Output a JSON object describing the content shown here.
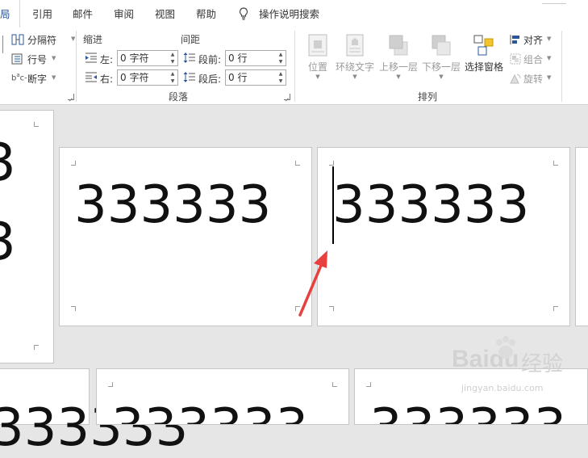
{
  "tabs": {
    "active": "局",
    "items": [
      "引用",
      "邮件",
      "审阅",
      "视图",
      "帮助"
    ],
    "tell_me": "操作说明搜索"
  },
  "ribbon": {
    "page_setup": {
      "breaks": "分隔符",
      "line_numbers": "行号",
      "hyphenation": "断字"
    },
    "paragraph": {
      "indent_label": "缩进",
      "spacing_label": "间距",
      "left_label": "左:",
      "left_value": "0 字符",
      "right_label": "右:",
      "right_value": "0 字符",
      "before_label": "段前:",
      "before_value": "0 行",
      "after_label": "段后:",
      "after_value": "0 行",
      "group_label": "段落"
    },
    "arrange": {
      "position": "位置",
      "wrap_text": "环绕文字",
      "bring_forward": "上移一层",
      "send_backward": "下移一层",
      "selection_pane": "选择窗格",
      "align": "对齐",
      "group": "组合",
      "rotate": "旋转",
      "group_label": "排列"
    }
  },
  "document": {
    "label_text": "333333",
    "partial_digit": "3"
  },
  "watermark": {
    "brand": "Baidu",
    "brand_cn": "经验",
    "url": "jingyan.baidu.com"
  },
  "colors": {
    "accent": "#2b579a",
    "arrow": "#e8403f"
  }
}
